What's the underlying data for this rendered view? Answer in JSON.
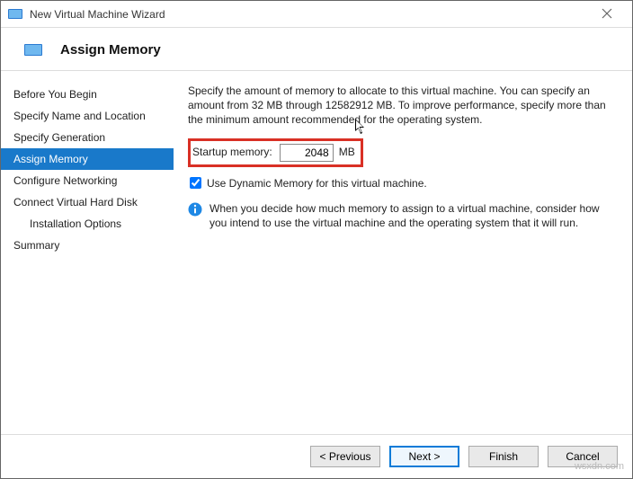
{
  "window": {
    "title": "New Virtual Machine Wizard"
  },
  "header": {
    "title": "Assign Memory"
  },
  "sidebar": {
    "steps": [
      {
        "label": "Before You Begin"
      },
      {
        "label": "Specify Name and Location"
      },
      {
        "label": "Specify Generation"
      },
      {
        "label": "Assign Memory"
      },
      {
        "label": "Configure Networking"
      },
      {
        "label": "Connect Virtual Hard Disk"
      },
      {
        "label": "Installation Options"
      },
      {
        "label": "Summary"
      }
    ],
    "active_index": 3
  },
  "main": {
    "description": "Specify the amount of memory to allocate to this virtual machine. You can specify an amount from 32 MB through 12582912 MB. To improve performance, specify more than the minimum amount recommended for the operating system.",
    "memory_label": "Startup memory:",
    "memory_value": "2048",
    "memory_unit": "MB",
    "dynamic_memory_label": "Use Dynamic Memory for this virtual machine.",
    "dynamic_memory_checked": true,
    "info_text": "When you decide how much memory to assign to a virtual machine, consider how you intend to use the virtual machine and the operating system that it will run."
  },
  "footer": {
    "previous": "< Previous",
    "next": "Next >",
    "finish": "Finish",
    "cancel": "Cancel"
  },
  "watermark": "wsxdn.com"
}
